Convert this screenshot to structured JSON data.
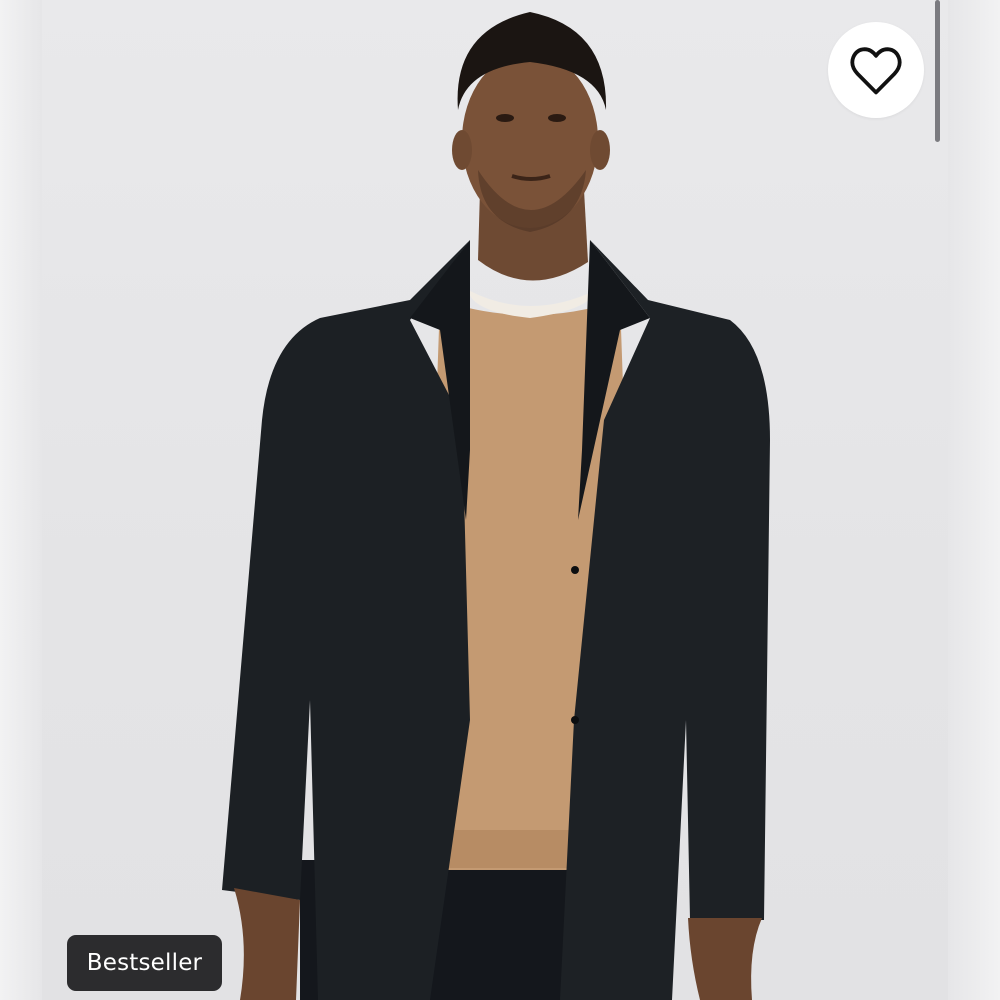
{
  "product": {
    "badge_label": "Bestseller",
    "favorite_icon": "heart-outline-icon",
    "favorited": false
  },
  "colors": {
    "background": "#e6e6e8",
    "badge_background": "#2c2c2e",
    "badge_text": "#ffffff",
    "favorite_button": "#ffffff",
    "blazer": "#1c2024",
    "sweater": "#c49a72"
  }
}
